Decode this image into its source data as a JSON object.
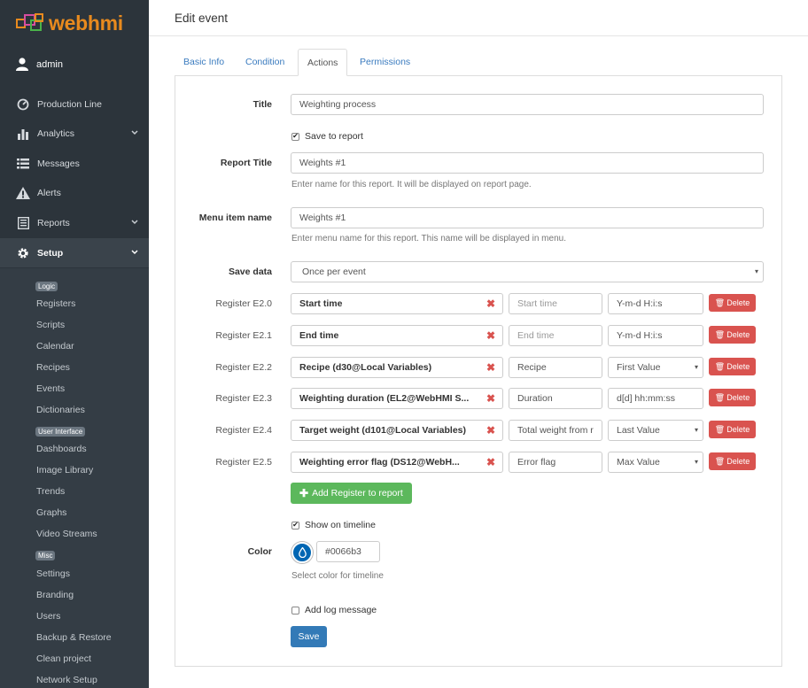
{
  "app": {
    "logo_text": "webhmi",
    "user": "admin"
  },
  "sidebar": {
    "nav": [
      {
        "label": "Production Line",
        "icon": "dashboard-gauge-icon"
      },
      {
        "label": "Analytics",
        "icon": "bar-chart-icon"
      },
      {
        "label": "Messages",
        "icon": "list-icon"
      },
      {
        "label": "Alerts",
        "icon": "warning-icon"
      },
      {
        "label": "Reports",
        "icon": "report-icon"
      },
      {
        "label": "Setup",
        "icon": "gear-icon"
      }
    ],
    "groups": {
      "logic": "Logic",
      "ui": "User Interface",
      "misc": "Misc"
    },
    "logic_items": [
      "Registers",
      "Scripts",
      "Calendar",
      "Recipes",
      "Events",
      "Dictionaries"
    ],
    "ui_items": [
      "Dashboards",
      "Image Library",
      "Trends",
      "Graphs",
      "Video Streams"
    ],
    "misc_items": [
      "Settings",
      "Branding",
      "Users",
      "Backup & Restore",
      "Clean project",
      "Network Setup"
    ]
  },
  "page": {
    "title": "Edit event",
    "tabs": [
      "Basic Info",
      "Condition",
      "Actions",
      "Permissions"
    ],
    "active_tab": "Actions"
  },
  "form": {
    "title_label": "Title",
    "title_value": "Weighting process",
    "save_to_report": "Save to report",
    "report_title_label": "Report Title",
    "report_title_value": "Weights #1",
    "report_title_help": "Enter name for this report. It will be displayed on report page.",
    "menu_item_label": "Menu item name",
    "menu_item_value": "Weights #1",
    "menu_item_help": "Enter menu name for this report. This name will be displayed in menu.",
    "save_data_label": "Save data",
    "save_data_value": "Once per event",
    "registers": [
      {
        "label": "Register E2.0",
        "register": "Start time",
        "title_ph": "Start time",
        "title": "",
        "format": "Y-m-d H:i:s",
        "format_is_select": false
      },
      {
        "label": "Register E2.1",
        "register": "End time",
        "title_ph": "End time",
        "title": "",
        "format": "Y-m-d H:i:s",
        "format_is_select": false
      },
      {
        "label": "Register E2.2",
        "register": "Recipe (d30@Local Variables)",
        "title_ph": "",
        "title": "Recipe",
        "format": "First Value",
        "format_is_select": true
      },
      {
        "label": "Register E2.3",
        "register": "Weighting duration (EL2@WebHMI S...",
        "title_ph": "",
        "title": "Duration",
        "format": "d[d] hh:mm:ss",
        "format_is_select": false
      },
      {
        "label": "Register E2.4",
        "register": "Target weight (d101@Local Variables)",
        "title_ph": "",
        "title": "Total weight from r",
        "format": "Last Value",
        "format_is_select": true
      },
      {
        "label": "Register E2.5",
        "register": "Weighting error flag (DS12@WebH...",
        "title_ph": "",
        "title": "Error flag",
        "format": "Max Value",
        "format_is_select": true
      }
    ],
    "delete_label": "Delete",
    "add_register_label": "Add Register to report",
    "show_on_timeline": "Show on timeline",
    "color_label": "Color",
    "color_value": "#0066b3",
    "color_help": "Select color for timeline",
    "add_log_message": "Add log message",
    "save_label": "Save"
  },
  "colors": {
    "sidebar_bg": "#2c343b",
    "accent_orange": "#e88a1e",
    "danger": "#d9534f",
    "success": "#5cb85c",
    "primary": "#337ab7",
    "timeline_color": "#0066b3"
  }
}
